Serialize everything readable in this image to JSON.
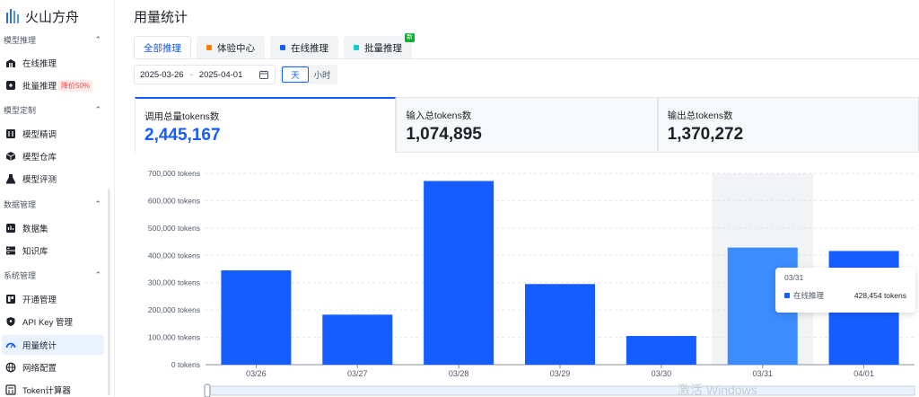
{
  "app": {
    "name": "火山方舟"
  },
  "sidebar": {
    "sections": [
      {
        "title": "模型推理",
        "items": [
          {
            "label": "在线推理",
            "icon": "building-icon"
          },
          {
            "label": "批量推理",
            "icon": "batch-icon",
            "badge": "降价50%"
          }
        ]
      },
      {
        "title": "模型定制",
        "items": [
          {
            "label": "模型精调",
            "icon": "tune-icon"
          },
          {
            "label": "模型仓库",
            "icon": "cube-icon"
          },
          {
            "label": "模型评测",
            "icon": "flask-icon"
          }
        ]
      },
      {
        "title": "数据管理",
        "items": [
          {
            "label": "数据集",
            "icon": "dataset-icon"
          },
          {
            "label": "知识库",
            "icon": "knowledge-icon"
          }
        ]
      },
      {
        "title": "系统管理",
        "items": [
          {
            "label": "开通管理",
            "icon": "activate-icon"
          },
          {
            "label": "API Key 管理",
            "icon": "shield-icon"
          },
          {
            "label": "用量统计",
            "icon": "gauge-icon",
            "active": true
          },
          {
            "label": "网络配置",
            "icon": "globe-icon"
          },
          {
            "label": "Token计算器",
            "icon": "calculator-icon"
          }
        ]
      }
    ]
  },
  "page": {
    "title": "用量统计"
  },
  "tabs": [
    {
      "label": "全部推理",
      "active": true
    },
    {
      "label": "体验中心",
      "dot": "#ff7d00"
    },
    {
      "label": "在线推理",
      "dot": "#165dff"
    },
    {
      "label": "批量推理",
      "dot": "#14c9c9",
      "badge": "新"
    }
  ],
  "filters": {
    "date_start": "2025-03-26",
    "date_sep": "-",
    "date_end": "2025-04-01",
    "granularity": [
      {
        "label": "天",
        "active": true
      },
      {
        "label": "小时"
      }
    ]
  },
  "stats": [
    {
      "label": "调用总量tokens数",
      "value": "2,445,167",
      "active": true
    },
    {
      "label": "输入总tokens数",
      "value": "1,074,895"
    },
    {
      "label": "输出总tokens数",
      "value": "1,370,272"
    }
  ],
  "chart_data": {
    "type": "bar",
    "categories": [
      "03/26",
      "03/27",
      "03/28",
      "03/29",
      "03/30",
      "03/31",
      "04/01"
    ],
    "series": [
      {
        "name": "在线推理",
        "values": [
          345000,
          183000,
          672000,
          295000,
          105000,
          428454,
          416000
        ]
      }
    ],
    "ylim": [
      0,
      700000
    ],
    "y_ticks": [
      "0 tokens",
      "100,000 tokens",
      "200,000 tokens",
      "300,000 tokens",
      "400,000 tokens",
      "500,000 tokens",
      "600,000 tokens",
      "700,000 tokens"
    ],
    "y_tick_values": [
      0,
      100000,
      200000,
      300000,
      400000,
      500000,
      600000,
      700000
    ],
    "highlight_index": 5,
    "color": "#165dff",
    "highlight_color": "#3c8cff",
    "grid": true
  },
  "tooltip": {
    "title": "03/31",
    "series": "在线推理",
    "value": "428,454 tokens"
  },
  "watermark": "激活 Windows"
}
